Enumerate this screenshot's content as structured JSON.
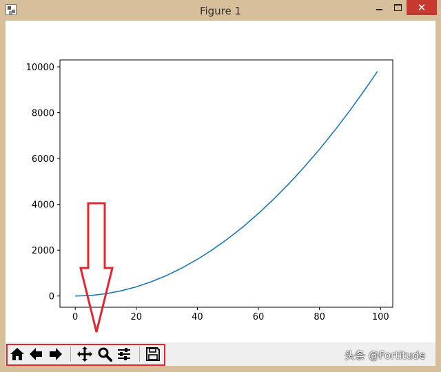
{
  "window": {
    "title": "Figure 1",
    "close_glyph": "✕",
    "icons": [
      "matplotlib-icon",
      "minimize-icon",
      "maximize-icon",
      "close-icon"
    ]
  },
  "toolbar": {
    "buttons": [
      {
        "name": "home",
        "icon": "home-icon"
      },
      {
        "name": "back",
        "icon": "arrow-left-icon"
      },
      {
        "name": "forward",
        "icon": "arrow-right-icon"
      },
      {
        "name": "pan",
        "icon": "move-icon"
      },
      {
        "name": "zoom",
        "icon": "magnifier-icon"
      },
      {
        "name": "subplots",
        "icon": "sliders-icon"
      },
      {
        "name": "save",
        "icon": "floppy-disk-icon"
      }
    ]
  },
  "annotation": {
    "color": "#e0282e",
    "shape": "down-arrow pointing at toolbar, box around toolbar buttons"
  },
  "watermark": "头条 @Fortitude",
  "chart_data": {
    "type": "line",
    "title": "",
    "xlabel": "",
    "ylabel": "",
    "xlim": [
      -5,
      104
    ],
    "ylim": [
      -490,
      10300
    ],
    "xticks": [
      0,
      20,
      40,
      60,
      80,
      100
    ],
    "yticks": [
      0,
      2000,
      4000,
      6000,
      8000,
      10000
    ],
    "grid": false,
    "series": [
      {
        "color": "#1f77b4",
        "x": [
          0,
          5,
          10,
          15,
          20,
          25,
          30,
          35,
          40,
          45,
          50,
          55,
          60,
          65,
          70,
          75,
          80,
          85,
          90,
          95,
          99
        ],
        "y": [
          0,
          25,
          100,
          225,
          400,
          625,
          900,
          1225,
          1600,
          2025,
          2500,
          3025,
          3600,
          4225,
          4900,
          5625,
          6400,
          7225,
          8100,
          9025,
          9801
        ]
      }
    ]
  }
}
